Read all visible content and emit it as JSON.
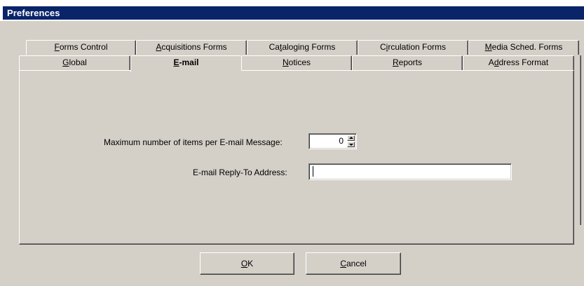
{
  "window": {
    "title": "Preferences"
  },
  "tabs_row1": [
    {
      "key": "forms_control",
      "accel": "F",
      "rest": "orms Control",
      "pre": ""
    },
    {
      "key": "acquisitions_forms",
      "accel": "A",
      "rest": "cquisitions Forms",
      "pre": ""
    },
    {
      "key": "cataloging_forms",
      "pre": "Ca",
      "accel": "t",
      "rest": "aloging Forms"
    },
    {
      "key": "circulation_forms",
      "pre": "C",
      "accel": "i",
      "rest": "rculation Forms"
    },
    {
      "key": "media_sched_forms",
      "pre": "",
      "accel": "M",
      "rest": "edia Sched. Forms"
    }
  ],
  "tabs_row2": [
    {
      "key": "global",
      "pre": "",
      "accel": "G",
      "rest": "lobal"
    },
    {
      "key": "email",
      "pre": "",
      "accel": "E",
      "rest": "-mail",
      "active": true
    },
    {
      "key": "notices",
      "pre": "",
      "accel": "N",
      "rest": "otices"
    },
    {
      "key": "reports",
      "pre": "",
      "accel": "R",
      "rest": "eports"
    },
    {
      "key": "address_format",
      "pre": "A",
      "accel": "d",
      "rest": "dress Format"
    }
  ],
  "email_settings": {
    "max_items_label": "Maximum number of items per E-mail Message:",
    "max_items_value": "0",
    "reply_to_label": "E-mail Reply-To Address:",
    "reply_to_value": ""
  },
  "buttons": {
    "ok": {
      "accel": "O",
      "rest": "K"
    },
    "cancel": {
      "accel": "C",
      "rest": "ancel"
    }
  }
}
